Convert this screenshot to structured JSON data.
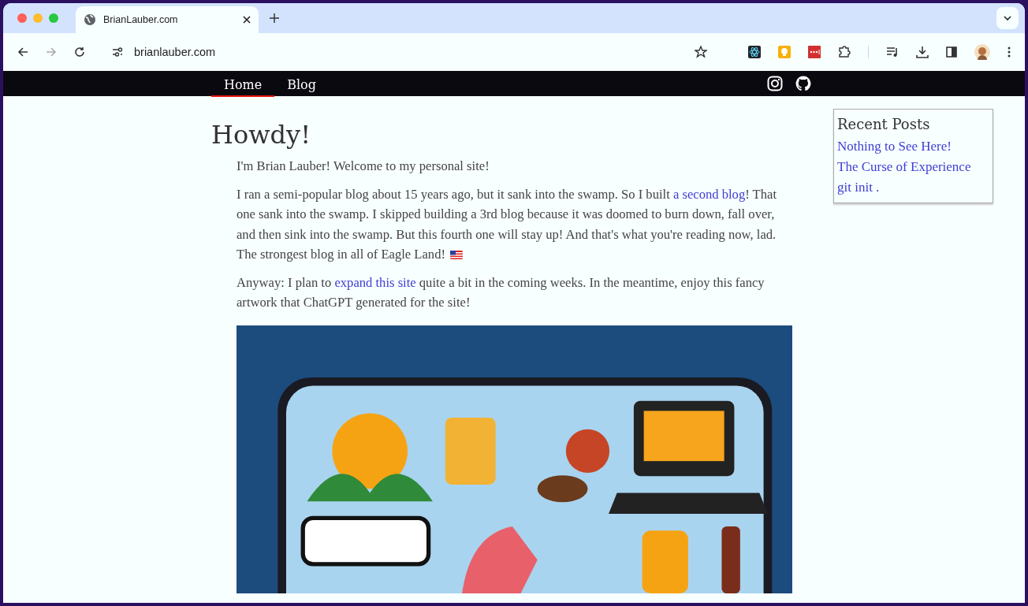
{
  "browser": {
    "tab_title": "BrianLauber.com",
    "url": "brianlauber.com"
  },
  "nav": {
    "items": [
      {
        "label": "Home",
        "selected": true
      },
      {
        "label": "Blog",
        "selected": false
      }
    ]
  },
  "main": {
    "heading": "Howdy!",
    "paragraphs": [
      [
        {
          "kind": "text",
          "text": "I'm Brian Lauber! Welcome to my personal site!"
        }
      ],
      [
        {
          "kind": "text",
          "text": "I ran a semi-popular blog about 15 years ago, but it sank into the swamp. So I built "
        },
        {
          "kind": "link",
          "text": "a second blog"
        },
        {
          "kind": "text",
          "text": "! That one sank into the swamp. I skipped building a 3rd blog because it was doomed to burn down, fall over, and then sink into the swamp. But this fourth one will stay up! And that's what you're reading now, lad. The strongest blog in all of Eagle Land!"
        },
        {
          "kind": "flag"
        }
      ],
      [
        {
          "kind": "text",
          "text": "Anyway: I plan to "
        },
        {
          "kind": "link",
          "text": "expand this site"
        },
        {
          "kind": "text",
          "text": " quite a bit in the coming weeks. In the meantime, enjoy this fancy artwork that ChatGPT generated for the site!"
        }
      ]
    ],
    "artwork": {
      "kind": "picture"
    }
  },
  "sidebar": {
    "title": "Recent Posts",
    "posts": [
      "Nothing to See Here!",
      "The Curse of Experience",
      "git init ."
    ]
  }
}
